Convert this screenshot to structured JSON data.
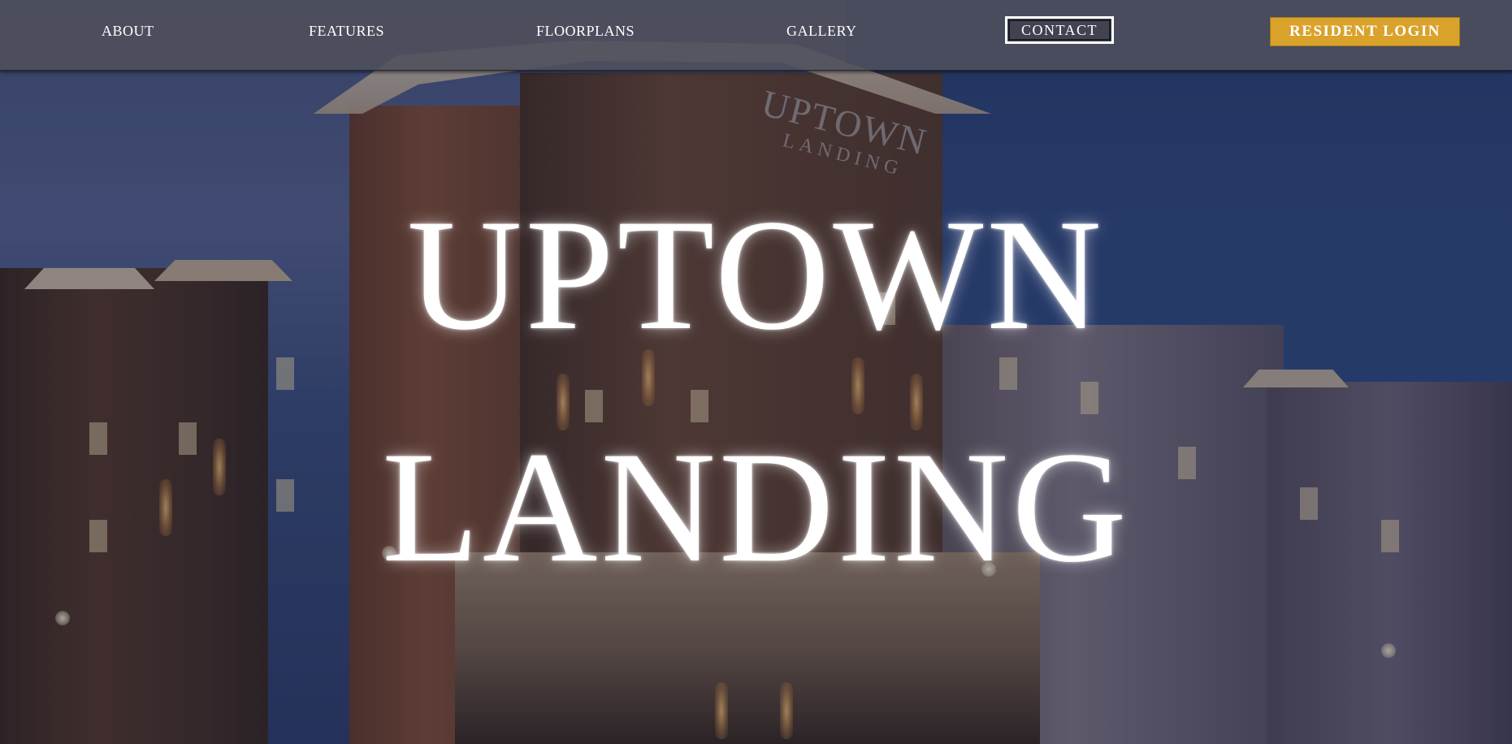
{
  "nav": {
    "about": "ABOUT",
    "features": "FEATURES",
    "floorplans": "FLOORPLANS",
    "gallery": "GALLERY",
    "contact": "CONTACT",
    "resident_login": "RESIDENT LOGIN"
  },
  "hero": {
    "line1": "UPTOWN",
    "line2": "LANDING",
    "building_sign_line1": "UPTOWN",
    "building_sign_line2": "LANDING"
  },
  "colors": {
    "accent": "#d9a22b",
    "nav_background": "#4e505c",
    "text": "#ffffff"
  }
}
